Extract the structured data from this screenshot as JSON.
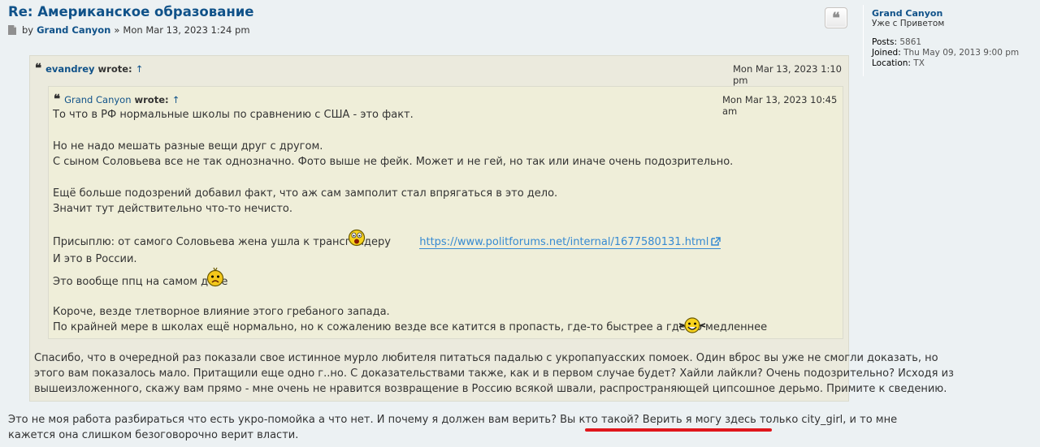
{
  "post": {
    "title": "Re: Американское образование",
    "by_label": "by",
    "author": "Grand Canyon",
    "separator": "»",
    "date": "Mon Mar 13, 2023 1:24 pm",
    "quote_button_icon": "quote-icon"
  },
  "profile": {
    "name": "Grand Canyon",
    "rank": "Уже с Приветом",
    "posts_label": "Posts:",
    "posts_value": "5861",
    "joined_label": "Joined:",
    "joined_value": "Thu May 09, 2013 9:00 pm",
    "location_label": "Location:",
    "location_value": "TX"
  },
  "outer_quote": {
    "author": "evandrey",
    "wrote": "wrote:",
    "arrow": "↑",
    "date": "Mon Mar 13, 2023 1:10 pm",
    "inner_quote": {
      "author": "Grand Canyon",
      "wrote": "wrote:",
      "arrow": "↑",
      "date": "Mon Mar 13, 2023 10:45 am",
      "lines": {
        "l1": "То что в РФ нормальные школы по сравнению с США - это факт.",
        "l2": "Но не надо мешать разные вещи друг с другом.",
        "l3": "С сыном Соловьева все не так однозначно. Фото выше не фейк. Может и не гей, но так или иначе очень подозрительно.",
        "l4": "Ещё больше подозрений добавил факт, что аж сам замполит стал впрягаться в это дело.",
        "l5": "Значит тут действительно что-то нечисто.",
        "l6": "Присыплю: от самого Соловьева жена ушла к трансгендеру",
        "link": "https://www.politforums.net/internal/1677580131.html",
        "l7": "И это в России.",
        "l8": "Это вообще ппц на самом деле",
        "l9": "Короче, везде тлетворное влияние этого гребаного запада.",
        "l10": "По крайней мере в школах ещё нормально, но к сожалению везде все катится в пропасть, где-то быстрее а где-то медленнее"
      }
    },
    "reply_lines": {
      "r1": "Спасибо, что в очередной раз показали свое истинное мурло любителя питаться падалью с укропапуасских помоек. Один вброс вы уже не смогли доказать, но",
      "r2": "этого вам показалось мало. Притащили еще одно г..но. С доказательствами также, как и в первом случае будет? Хайли лайкли? Очень подозрительно? Исходя из",
      "r3": "вышеизложенного, скажу вам прямо - мне очень не нравится возвращение в Россию всякой швали, распространяющей ципсошное дерьмо. Примите к сведению."
    }
  },
  "body_lines": {
    "b1_a": "Это не моя работа разбираться что есть укро-помойка а что нет. И почему я должен вам верить? Вы кто такой? ",
    "b1_b": "Верить я могу здесь только city_girl",
    "b1_c": ", и то мне",
    "b2": "кажется она слишком безоговорочно верит власти."
  },
  "colors": {
    "link": "#105289",
    "url": "#368ad2",
    "quote_bg": "#ebeadd",
    "inner_quote_bg": "#efeed9",
    "highlight_underline": "#e0171c"
  }
}
